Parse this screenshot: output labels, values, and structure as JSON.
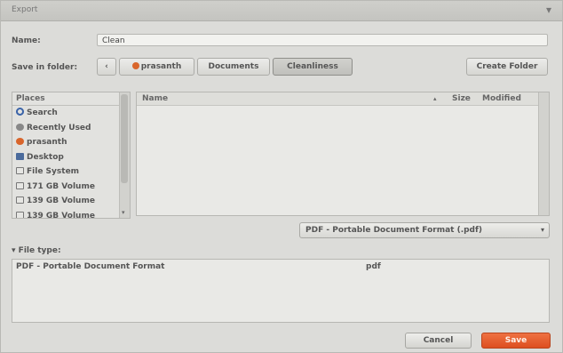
{
  "window": {
    "title": "Export",
    "close_glyph": "▾"
  },
  "name_field": {
    "label": "Name:",
    "value": "Clean"
  },
  "folder": {
    "label": "Save in folder:",
    "back_glyph": "‹",
    "crumbs": [
      "prasanth",
      "Documents",
      "Cleanliness"
    ],
    "create_folder_label": "Create Folder"
  },
  "places": {
    "header": "Places",
    "items": [
      {
        "label": "Search",
        "icon": "search-icon"
      },
      {
        "label": "Recently Used",
        "icon": "recent-icon"
      },
      {
        "label": "prasanth",
        "icon": "home-icon"
      },
      {
        "label": "Desktop",
        "icon": "desktop-icon"
      },
      {
        "label": "File System",
        "icon": "drive-icon"
      },
      {
        "label": "171 GB Volume",
        "icon": "drive-icon"
      },
      {
        "label": "139 GB Volume",
        "icon": "drive-icon"
      },
      {
        "label": "139 GB Volume",
        "icon": "drive-icon"
      }
    ],
    "scroll_down_glyph": "▾"
  },
  "files": {
    "columns": {
      "name": "Name",
      "sort_glyph": "▴",
      "size": "Size",
      "modified": "Modified"
    }
  },
  "filter": {
    "value": "PDF - Portable Document Format (.pdf)",
    "arrow": "▾"
  },
  "filetype": {
    "expander": "▾",
    "label": "File type:",
    "row": {
      "name": "PDF - Portable Document Format",
      "ext": "pdf"
    }
  },
  "buttons": {
    "cancel": "Cancel",
    "save": "Save"
  },
  "colors": {
    "accent": "#dd4f20",
    "window_bg": "#dcdcd9"
  }
}
